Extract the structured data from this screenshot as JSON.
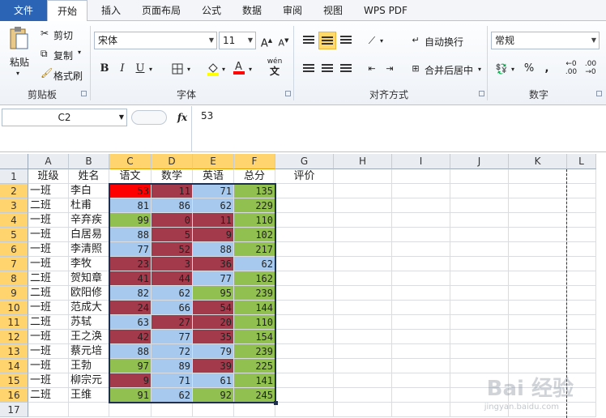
{
  "tabs": [
    {
      "label": "文件",
      "kind": "file"
    },
    {
      "label": "开始",
      "kind": "active"
    },
    {
      "label": "插入"
    },
    {
      "label": "页面布局"
    },
    {
      "label": "公式"
    },
    {
      "label": "数据"
    },
    {
      "label": "审阅"
    },
    {
      "label": "视图"
    },
    {
      "label": "WPS PDF"
    }
  ],
  "clipboard": {
    "paste": "粘贴",
    "cut": "剪切",
    "copy": "复制",
    "format_painter": "格式刷",
    "group": "剪贴板"
  },
  "font": {
    "name": "宋体",
    "size": "11",
    "bold": "B",
    "italic": "I",
    "underline": "U",
    "group": "字体"
  },
  "alignment": {
    "wrap": "自动换行",
    "merge": "合并后居中",
    "group": "对齐方式"
  },
  "number": {
    "format": "常规",
    "percent": "%",
    "comma": ",",
    "group": "数字"
  },
  "formula_bar": {
    "name_box": "C2",
    "fx": "fx",
    "value": "53"
  },
  "columns": [
    "A",
    "B",
    "C",
    "D",
    "E",
    "F",
    "G",
    "H",
    "I",
    "J",
    "K",
    "L"
  ],
  "selected_columns": [
    "C",
    "D",
    "E",
    "F"
  ],
  "rows": [
    "1",
    "2",
    "3",
    "4",
    "5",
    "6",
    "7",
    "8",
    "9",
    "10",
    "11",
    "12",
    "13",
    "14",
    "15",
    "16",
    "17"
  ],
  "headers": [
    "班级",
    "姓名",
    "语文",
    "数学",
    "英语",
    "总分",
    "评价"
  ],
  "students": [
    {
      "cls": "一班",
      "name": "李白",
      "scores": [
        53,
        11,
        71,
        135
      ],
      "colors": [
        "red",
        "maroon",
        "blue",
        "green"
      ]
    },
    {
      "cls": "二班",
      "name": "杜甫",
      "scores": [
        81,
        86,
        62,
        229
      ],
      "colors": [
        "blue",
        "blue",
        "blue",
        "green"
      ]
    },
    {
      "cls": "一班",
      "name": "辛弃疾",
      "scores": [
        99,
        0,
        11,
        110
      ],
      "colors": [
        "green",
        "maroon",
        "maroon",
        "green"
      ]
    },
    {
      "cls": "一班",
      "name": "白居易",
      "scores": [
        88,
        5,
        9,
        102
      ],
      "colors": [
        "blue",
        "maroon",
        "maroon",
        "green"
      ]
    },
    {
      "cls": "一班",
      "name": "李清照",
      "scores": [
        77,
        52,
        88,
        217
      ],
      "colors": [
        "blue",
        "maroon",
        "blue",
        "green"
      ]
    },
    {
      "cls": "一班",
      "name": "李牧",
      "scores": [
        23,
        3,
        36,
        62
      ],
      "colors": [
        "maroon",
        "maroon",
        "maroon",
        "blue"
      ]
    },
    {
      "cls": "二班",
      "name": "贺知章",
      "scores": [
        41,
        44,
        77,
        162
      ],
      "colors": [
        "maroon",
        "maroon",
        "blue",
        "green"
      ]
    },
    {
      "cls": "二班",
      "name": "欧阳修",
      "scores": [
        82,
        62,
        95,
        239
      ],
      "colors": [
        "blue",
        "blue",
        "green",
        "green"
      ]
    },
    {
      "cls": "一班",
      "name": "范成大",
      "scores": [
        24,
        66,
        54,
        144
      ],
      "colors": [
        "maroon",
        "blue",
        "maroon",
        "green"
      ]
    },
    {
      "cls": "二班",
      "name": "苏轼",
      "scores": [
        63,
        27,
        20,
        110
      ],
      "colors": [
        "blue",
        "maroon",
        "maroon",
        "green"
      ]
    },
    {
      "cls": "一班",
      "name": "王之涣",
      "scores": [
        42,
        77,
        35,
        154
      ],
      "colors": [
        "maroon",
        "blue",
        "maroon",
        "green"
      ]
    },
    {
      "cls": "一班",
      "name": "蔡元培",
      "scores": [
        88,
        72,
        79,
        239
      ],
      "colors": [
        "blue",
        "blue",
        "blue",
        "green"
      ]
    },
    {
      "cls": "一班",
      "name": "王勃",
      "scores": [
        97,
        89,
        39,
        225
      ],
      "colors": [
        "green",
        "blue",
        "maroon",
        "green"
      ]
    },
    {
      "cls": "一班",
      "name": "柳宗元",
      "scores": [
        9,
        71,
        61,
        141
      ],
      "colors": [
        "maroon",
        "blue",
        "blue",
        "green"
      ]
    },
    {
      "cls": "二班",
      "name": "王维",
      "scores": [
        91,
        62,
        92,
        245
      ],
      "colors": [
        "green",
        "blue",
        "green",
        "green"
      ]
    }
  ],
  "colors": {
    "file_tab": "#2b64b5",
    "header_highlight": "#ffd36e",
    "fill_blue": "#a7c9ed",
    "fill_green": "#92c050",
    "fill_maroon": "#a33a4b",
    "fill_red": "#ff0000"
  },
  "watermark": {
    "text": "Bai 经验",
    "sub": "jingyan.baidu.com"
  }
}
